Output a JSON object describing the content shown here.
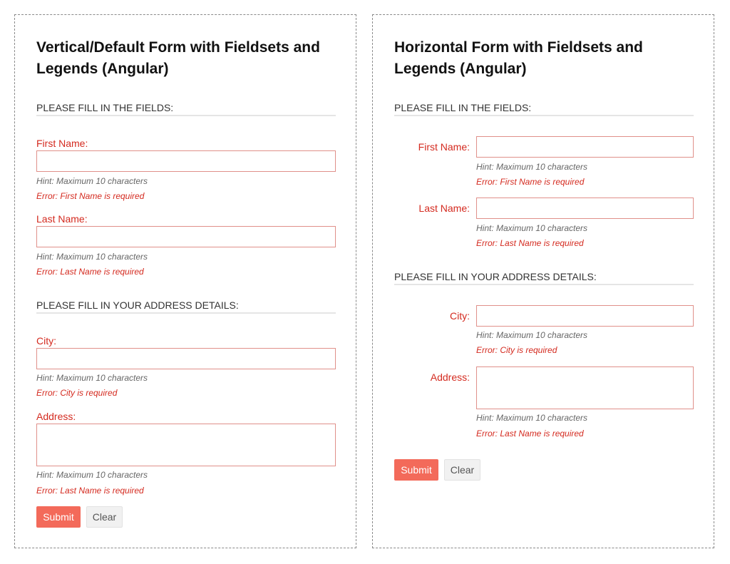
{
  "vertical_form": {
    "title": "Vertical/Default Form with Fieldsets and Legends (Angular)",
    "fieldset_personal": {
      "legend": "PLEASE FILL IN THE FIELDS:",
      "first_name": {
        "label": "First Name:",
        "value": "",
        "hint": "Hint: Maximum 10 characters",
        "error": "Error: First Name is required"
      },
      "last_name": {
        "label": "Last Name:",
        "value": "",
        "hint": "Hint: Maximum 10 characters",
        "error": "Error: Last Name is required"
      }
    },
    "fieldset_address": {
      "legend": "PLEASE FILL IN YOUR ADDRESS DETAILS:",
      "city": {
        "label": "City:",
        "value": "",
        "hint": "Hint: Maximum 10 characters",
        "error": "Error: City is required"
      },
      "address": {
        "label": "Address:",
        "value": "",
        "hint": "Hint: Maximum 10 characters",
        "error": "Error: Last Name is required"
      }
    },
    "submit_label": "Submit",
    "clear_label": "Clear"
  },
  "horizontal_form": {
    "title": "Horizontal Form with Fieldsets and Legends (Angular)",
    "fieldset_personal": {
      "legend": "PLEASE FILL IN THE FIELDS:",
      "first_name": {
        "label": "First Name:",
        "value": "",
        "hint": "Hint: Maximum 10 characters",
        "error": "Error: First Name is required"
      },
      "last_name": {
        "label": "Last Name:",
        "value": "",
        "hint": "Hint: Maximum 10 characters",
        "error": "Error: Last Name is required"
      }
    },
    "fieldset_address": {
      "legend": "PLEASE FILL IN YOUR ADDRESS DETAILS:",
      "city": {
        "label": "City:",
        "value": "",
        "hint": "Hint: Maximum 10 characters",
        "error": "Error: City is required"
      },
      "address": {
        "label": "Address:",
        "value": "",
        "hint": "Hint: Maximum 10 characters",
        "error": "Error: Last Name is required"
      }
    },
    "submit_label": "Submit",
    "clear_label": "Clear"
  },
  "colors": {
    "error": "#d42a1f",
    "submit_bg": "#f36a5a",
    "input_border": "#e0908a",
    "legend_rule": "#e5e5e5"
  }
}
